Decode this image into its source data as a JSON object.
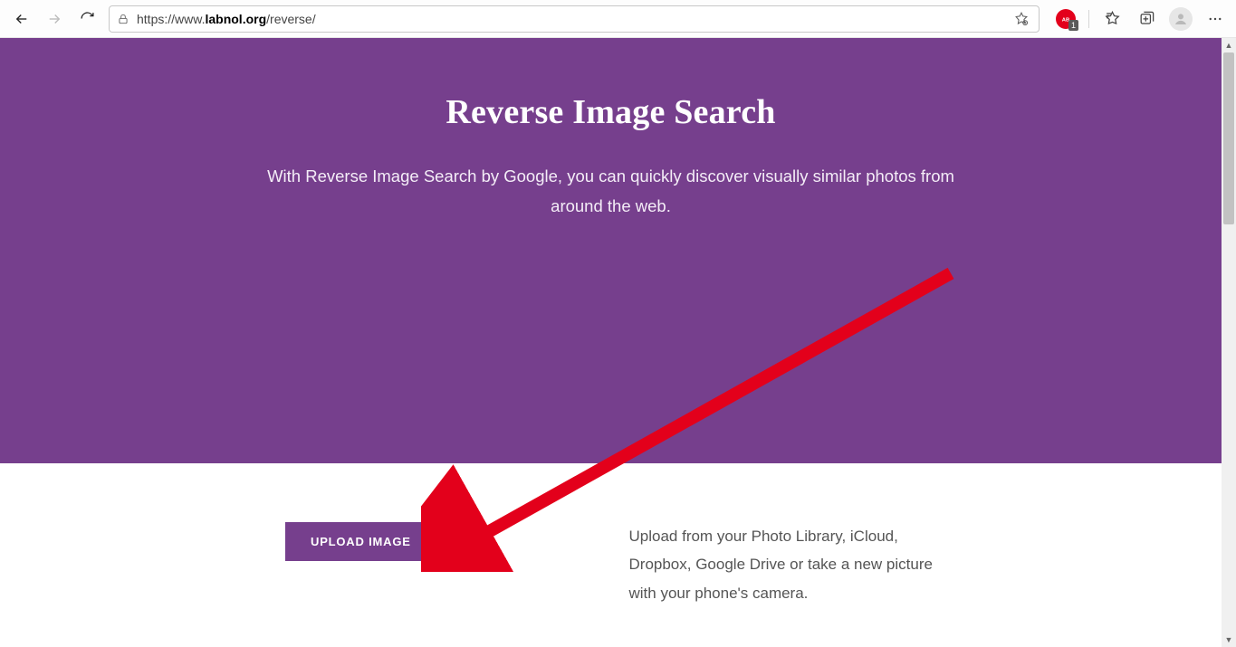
{
  "browser": {
    "url_host_pre": "https://www.",
    "url_host_bold": "labnol.org",
    "url_path": "/reverse/",
    "abp_badge": "1"
  },
  "hero": {
    "title": "Reverse Image Search",
    "subtitle": "With Reverse Image Search by Google, you can quickly discover visually similar photos from around the web."
  },
  "upload": {
    "button_label": "UPLOAD IMAGE",
    "description": "Upload from your Photo Library, iCloud, Dropbox, Google Drive or take a new picture with your phone's camera."
  }
}
